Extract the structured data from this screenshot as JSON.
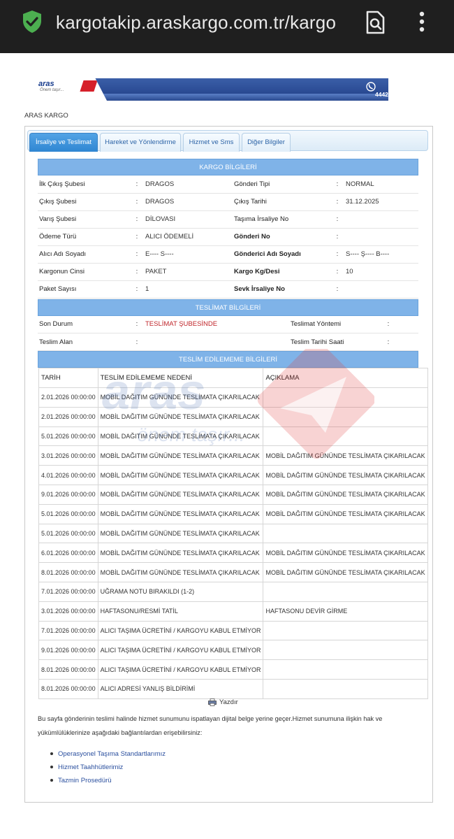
{
  "browser": {
    "url": "kargotakip.araskargo.com.tr/kargo",
    "icons": {
      "lock": "shield-check-icon",
      "page_search": "page-search-icon",
      "menu": "more-vertical-icon"
    }
  },
  "banner": {
    "logo": "aras",
    "logo_tagline": "Önem taşır...",
    "phone": "4442552",
    "icon": "phone-icon"
  },
  "brand_label": "ARAS KARGO",
  "tabs": [
    {
      "label": "İrsaliye ve Teslimat",
      "active": true
    },
    {
      "label": "Hareket ve Yönlendirme",
      "active": false
    },
    {
      "label": "Hizmet ve Sms",
      "active": false
    },
    {
      "label": "Diğer Bilgiler",
      "active": false
    }
  ],
  "kargo": {
    "header": "KARGO BİLGİLERİ",
    "rows": [
      {
        "l1": "İlk Çıkış Şubesi",
        "v1": "DRAGOS",
        "l2": "Gönderi Tipi",
        "v2": "NORMAL"
      },
      {
        "l1": "Çıkış Şubesi",
        "v1": "DRAGOS",
        "l2": "Çıkış Tarihi",
        "v2": "31.12.2025"
      },
      {
        "l1": "Varış Şubesi",
        "v1": "DİLOVASI",
        "l2": "Taşıma İrsaliye No",
        "v2": ""
      },
      {
        "l1": "Ödeme Türü",
        "v1": "ALICI ÖDEMELİ",
        "l2": "Gönderi No",
        "v2": ""
      },
      {
        "l1": "Alıcı Adı Soyadı",
        "v1": "E---- S----",
        "l2": "Gönderici Adı Soyadı",
        "v2": "S---- Ş---- B----"
      },
      {
        "l1": "Kargonun Cinsi",
        "v1": "PAKET",
        "l2": "Kargo Kg/Desi",
        "v2": "10"
      },
      {
        "l1": "Paket Sayısı",
        "v1": "1",
        "l2": "Sevk İrsaliye No",
        "v2": ""
      }
    ]
  },
  "teslimat": {
    "header": "TESLİMAT BİLGİLERİ",
    "rows": [
      {
        "l1": "Son Durum",
        "v1": "TESLİMAT ŞUBESİNDE",
        "l2": "Teslimat Yöntemi",
        "v2": ""
      },
      {
        "l1": "Teslim Alan",
        "v1": "",
        "l2": "Teslim Tarihi Saati",
        "v2": ""
      }
    ]
  },
  "failures": {
    "header": "TESLİM EDİLEMEME BİLGİLERİ",
    "columns": [
      "TARİH",
      "TESLİM EDİLEMEME NEDENİ",
      "AÇIKLAMA"
    ],
    "rows": [
      [
        "2.01.2026 00:00:00",
        "MOBİL DAĞITIM GÜNÜNDE TESLİMATA ÇIKARILACAK",
        ""
      ],
      [
        "2.01.2026 00:00:00",
        "MOBİL DAĞITIM GÜNÜNDE TESLİMATA ÇIKARILACAK",
        ""
      ],
      [
        "5.01.2026 00:00:00",
        "MOBİL DAĞITIM GÜNÜNDE TESLİMATA ÇIKARILACAK",
        ""
      ],
      [
        "3.01.2026 00:00:00",
        "MOBİL DAĞITIM GÜNÜNDE TESLİMATA ÇIKARILACAK",
        "MOBİL DAĞITIM GÜNÜNDE TESLİMATA ÇIKARILACAK"
      ],
      [
        "4.01.2026 00:00:00",
        "MOBİL DAĞITIM GÜNÜNDE TESLİMATA ÇIKARILACAK",
        "MOBİL DAĞITIM GÜNÜNDE TESLİMATA ÇIKARILACAK"
      ],
      [
        "9.01.2026 00:00:00",
        "MOBİL DAĞITIM GÜNÜNDE TESLİMATA ÇIKARILACAK",
        "MOBİL DAĞITIM GÜNÜNDE TESLİMATA ÇIKARILACAK"
      ],
      [
        "5.01.2026 00:00:00",
        "MOBİL DAĞITIM GÜNÜNDE TESLİMATA ÇIKARILACAK",
        "MOBİL DAĞITIM GÜNÜNDE TESLİMATA ÇIKARILACAK"
      ],
      [
        "5.01.2026 00:00:00",
        "MOBİL DAĞITIM GÜNÜNDE TESLİMATA ÇIKARILACAK",
        ""
      ],
      [
        "6.01.2026 00:00:00",
        "MOBİL DAĞITIM GÜNÜNDE TESLİMATA ÇIKARILACAK",
        "MOBİL DAĞITIM GÜNÜNDE TESLİMATA ÇIKARILACAK"
      ],
      [
        "8.01.2026 00:00:00",
        "MOBİL DAĞITIM GÜNÜNDE TESLİMATA ÇIKARILACAK",
        "MOBİL DAĞITIM GÜNÜNDE TESLİMATA ÇIKARILACAK"
      ],
      [
        "7.01.2026 00:00:00",
        "UĞRAMA NOTU BIRAKILDI (1-2)",
        ""
      ],
      [
        "3.01.2026 00:00:00",
        "HAFTASONU/RESMİ TATİL",
        "HAFTASONU DEVİR GİRME"
      ],
      [
        "7.01.2026 00:00:00",
        "ALICI TAŞIMA ÜCRETİNİ / KARGOYU KABUL ETMİYOR",
        ""
      ],
      [
        "9.01.2026 00:00:00",
        "ALICI TAŞIMA ÜCRETİNİ / KARGOYU KABUL ETMİYOR",
        ""
      ],
      [
        "8.01.2026 00:00:00",
        "ALICI TAŞIMA ÜCRETİNİ / KARGOYU KABUL ETMİYOR",
        ""
      ],
      [
        "8.01.2026 00:00:00",
        "ALICI ADRESİ YANLIŞ BİLDİRİMİ",
        ""
      ]
    ]
  },
  "print_label": "Yazdır",
  "note": "Bu sayfa gönderinin teslimi halinde hizmet sunumunu ispatlayan dijital belge yerine geçer.Hizmet sunumuna ilişkin hak ve yükümlülüklerinize aşağıdaki bağlantılardan erişebilirsiniz:",
  "links": [
    "Operasyonel Taşıma Standartlarımız",
    "Hizmet Taahhütlerimiz",
    "Tazmin Prosedürü"
  ],
  "colors": {
    "accent": "#2f86d2",
    "section_header": "#7fb3e8",
    "status_red": "#c0262b",
    "banner_blue": "#2c4d96",
    "link": "#2a4f9e"
  }
}
